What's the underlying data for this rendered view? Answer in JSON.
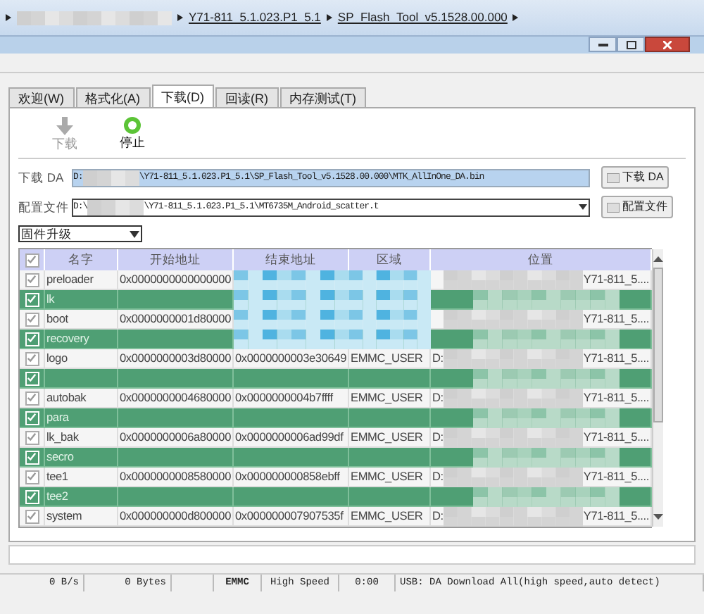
{
  "explorer": {
    "path": [
      "Y71-811_5.1.023.P1_5.1",
      "SP_Flash_Tool_v5.1528.00.000"
    ]
  },
  "tabs": [
    {
      "label": "欢迎(W)",
      "selected": false
    },
    {
      "label": "格式化(A)",
      "selected": false
    },
    {
      "label": "下载(D)",
      "selected": true
    },
    {
      "label": "回读(R)",
      "selected": false
    },
    {
      "label": "内存测试(T)",
      "selected": false
    }
  ],
  "toolbar": [
    {
      "label": "下载",
      "kind": "download",
      "disabled": true
    },
    {
      "label": "停止",
      "kind": "stop",
      "disabled": false
    }
  ],
  "da": {
    "label": "下载 DA",
    "prefix": "D:",
    "suffix": "\\Y71-811_5.1.023.P1_5.1\\SP_Flash_Tool_v5.1528.00.000\\MTK_AllInOne_DA.bin",
    "button": "下载 DA"
  },
  "scatter": {
    "label": "配置文件",
    "prefix": "D:\\",
    "suffix": "\\Y71-811_5.1.023.P1_5.1\\MT6735M_Android_scatter.t",
    "button": "配置文件"
  },
  "mode": {
    "value": "固件升级"
  },
  "table": {
    "all_checked": true,
    "columns": [
      "名字",
      "开始地址",
      "结束地址",
      "区域",
      "位置"
    ],
    "rows": [
      {
        "checked": true,
        "highlighted": false,
        "blurred": true,
        "name": "preloader",
        "start": "0x0000000000000000",
        "loc_end": "Y71-811_5...."
      },
      {
        "checked": true,
        "highlighted": true,
        "blurred": true,
        "name": "lk"
      },
      {
        "checked": true,
        "highlighted": false,
        "blurred": true,
        "name": "boot",
        "start": "0x0000000001d80000",
        "loc_end": "Y71-811_5...."
      },
      {
        "checked": true,
        "highlighted": true,
        "blurred": true,
        "name": "recovery"
      },
      {
        "checked": true,
        "highlighted": false,
        "name": "logo",
        "start": "0x0000000003d80000",
        "end": "0x0000000003e30649",
        "region": "EMMC_USER",
        "loc_start": "D:",
        "loc_end": "Y71-811_5...."
      },
      {
        "checked": true,
        "highlighted": true,
        "name": "",
        "start": "",
        "end": "",
        "loc_start": "",
        "loc_end": ""
      },
      {
        "checked": true,
        "highlighted": false,
        "name": "autobak",
        "start": "0x0000000004680000",
        "end": "0x0000000004b7ffff",
        "region": "EMMC_USER",
        "loc_start": "D:",
        "loc_end": "Y71-811_5...."
      },
      {
        "checked": true,
        "highlighted": true,
        "name": "para",
        "start": "",
        "end": "",
        "loc_start": "",
        "loc_end": ""
      },
      {
        "checked": true,
        "highlighted": false,
        "name": "lk_bak",
        "start": "0x0000000006a80000",
        "end": "0x0000000006ad99df",
        "region": "EMMC_USER",
        "loc_start": "D:",
        "loc_end": "Y71-811_5...."
      },
      {
        "checked": true,
        "highlighted": true,
        "name": "secro",
        "start": "",
        "end": "",
        "loc_start": "",
        "loc_end": ""
      },
      {
        "checked": true,
        "highlighted": false,
        "name": "tee1",
        "start": "0x0000000008580000",
        "end": "0x000000000858ebff",
        "region": "EMMC_USER",
        "loc_start": "D:",
        "loc_end": "Y71-811_5...."
      },
      {
        "checked": true,
        "highlighted": true,
        "name": "tee2",
        "start": "",
        "end": "",
        "loc_start": "",
        "loc_end": ""
      },
      {
        "checked": true,
        "highlighted": false,
        "name": "system",
        "start": "0x000000000d800000",
        "end": "0x000000007907535f",
        "region": "EMMC_USER",
        "loc_start": "D:",
        "loc_end": "Y71-811_5...."
      }
    ]
  },
  "progress": {
    "level": 0
  },
  "status_bar": [
    "0 B/s",
    "0 Bytes",
    "EMMC",
    "High Speed",
    "0:00",
    "USB: DA Download All(high speed,auto detect)"
  ]
}
